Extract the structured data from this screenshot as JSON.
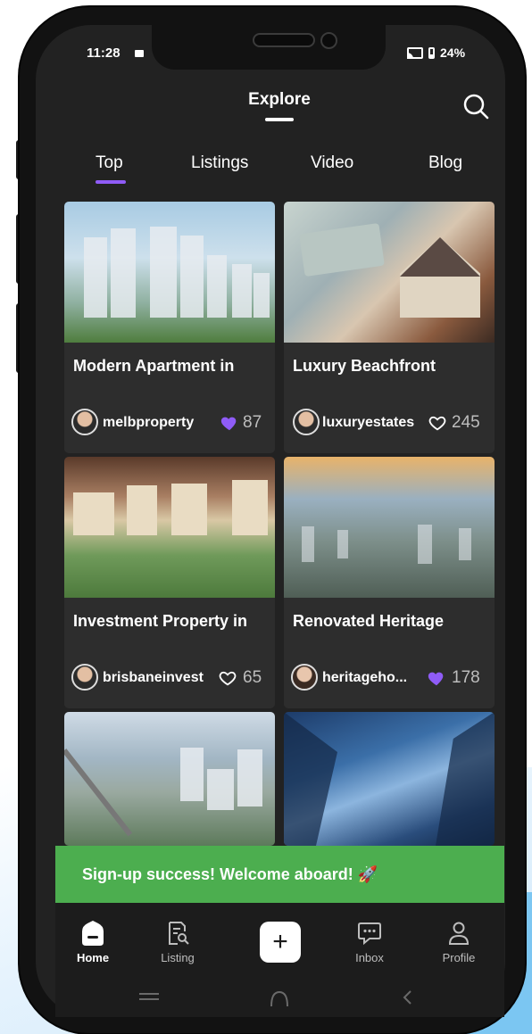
{
  "status": {
    "time": "11:28",
    "battery": "24%"
  },
  "header": {
    "title": "Explore"
  },
  "tabs": [
    {
      "label": "Top",
      "active": true
    },
    {
      "label": "Listings",
      "active": false
    },
    {
      "label": "Video",
      "active": false
    },
    {
      "label": "Blog",
      "active": false
    }
  ],
  "cards": [
    {
      "title": "Modern Apartment in",
      "author": "melbproperty",
      "likes": "87",
      "liked": true
    },
    {
      "title": "Luxury Beachfront",
      "author": "luxuryestates",
      "likes": "245",
      "liked": false
    },
    {
      "title": "Investment Property in",
      "author": "brisbaneinvest",
      "likes": "65",
      "liked": false
    },
    {
      "title": "Renovated Heritage",
      "author": "heritageho...",
      "likes": "178",
      "liked": true
    },
    {
      "title": "",
      "author": "",
      "likes": "",
      "liked": false
    },
    {
      "title": "",
      "author": "",
      "likes": "",
      "liked": false
    }
  ],
  "toast": {
    "message": "Sign-up success! Welcome aboard! 🚀"
  },
  "nav": {
    "home": "Home",
    "listing": "Listing",
    "inbox": "Inbox",
    "profile": "Profile",
    "add_symbol": "+"
  },
  "colors": {
    "accent": "#8f5cf7",
    "toast": "#4cae4f",
    "background": "#222222",
    "card": "#2d2d2d"
  }
}
